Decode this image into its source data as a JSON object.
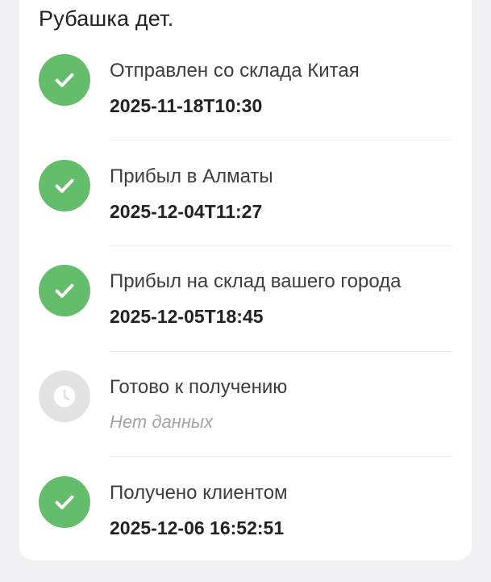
{
  "product": {
    "title": "Рубашка дет."
  },
  "colors": {
    "done": "#63bd6a",
    "pending": "#e2e2e2"
  },
  "steps": [
    {
      "label": "Отправлен со склада Китая",
      "value": "2025-11-18T10:30",
      "status": "done",
      "icon": "check-icon"
    },
    {
      "label": "Прибыл в Алматы",
      "value": "2025-12-04T11:27",
      "status": "done",
      "icon": "check-icon"
    },
    {
      "label": "Прибыл на склад вашего города",
      "value": "2025-12-05T18:45",
      "status": "done",
      "icon": "check-icon"
    },
    {
      "label": "Готово к получению",
      "value": "Нет данных",
      "status": "pending",
      "icon": "clock-icon"
    },
    {
      "label": "Получено клиентом",
      "value": "2025-12-06 16:52:51",
      "status": "done",
      "icon": "check-icon"
    }
  ]
}
